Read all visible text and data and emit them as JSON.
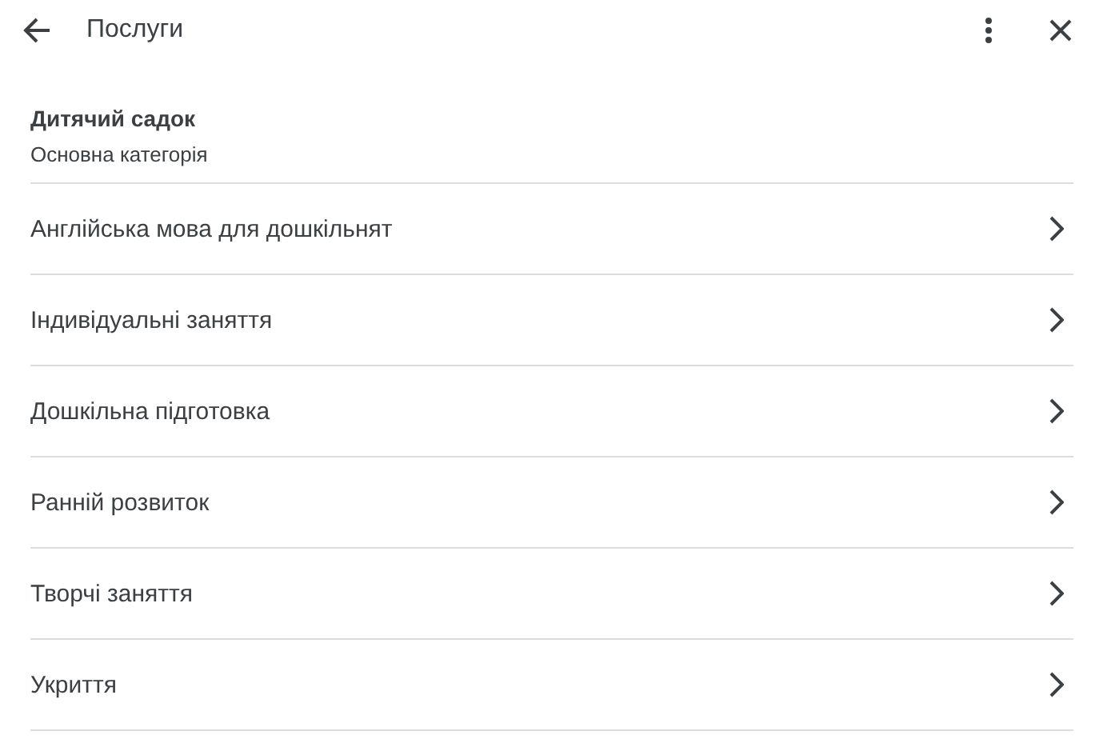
{
  "header": {
    "title": "Послуги"
  },
  "category": {
    "title": "Дитячий садок",
    "subtitle": "Основна категорія"
  },
  "items": [
    {
      "label": "Англійська мова для дошкільнят"
    },
    {
      "label": "Індивідуальні заняття"
    },
    {
      "label": "Дошкільна підготовка"
    },
    {
      "label": "Ранній розвиток"
    },
    {
      "label": "Творчі заняття"
    },
    {
      "label": "Укриття"
    }
  ]
}
